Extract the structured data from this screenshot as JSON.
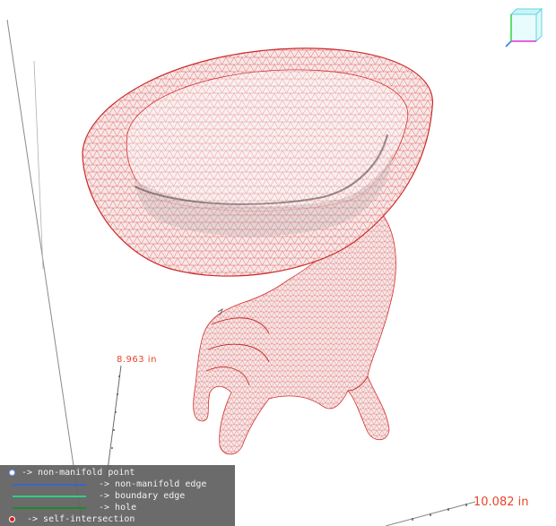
{
  "viewport": {
    "model_description": "Triangle-mesh 3D model: a bowl held up by a hand (mesh shown as red wireframe over white shading)",
    "dimensions": {
      "height_label": "8.963 in",
      "width_label": "10.082 in"
    },
    "colors": {
      "mesh_wire": "#e23c3c",
      "mesh_fill": "#f3e3e3",
      "dimension_text": "#e8442a",
      "legend_bg": "#626262"
    },
    "view_cube_icon": "view-orientation-cube-icon"
  },
  "legend": {
    "items": [
      {
        "marker": "point",
        "label": "-> non-manifold point",
        "color": "#ffffff"
      },
      {
        "marker": "line",
        "label": "-> non-manifold edge",
        "color": "#3c64c8"
      },
      {
        "marker": "line",
        "label": "-> boundary edge",
        "color": "#2ecf86"
      },
      {
        "marker": "line",
        "label": "-> hole",
        "color": "#1e8a2a"
      },
      {
        "marker": "dot",
        "label": "-> self-intersection",
        "color": "#d42020"
      }
    ]
  }
}
